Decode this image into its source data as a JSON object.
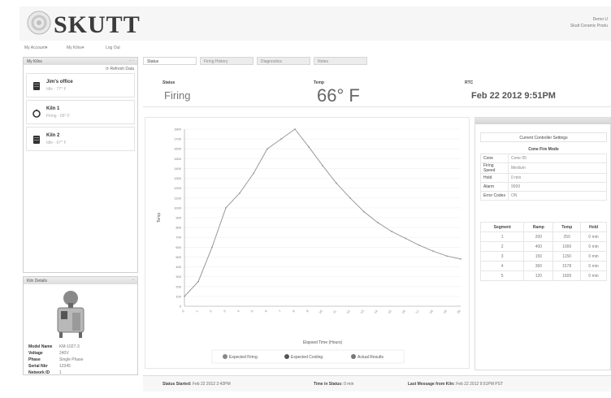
{
  "header": {
    "brand": "SKUTT",
    "user_name": "Demo U",
    "company": "Skutt Ceramic Produ"
  },
  "topnav": [
    {
      "label": "My Account▾"
    },
    {
      "label": "My Kilns▾"
    },
    {
      "label": "Log Out"
    }
  ],
  "kilns_panel": {
    "title": "My Kilns",
    "refresh_label": "Refresh Data",
    "items": [
      {
        "name": "Jim's office",
        "status": "Idle  ·  77° F",
        "icon": "kiln-idle-icon"
      },
      {
        "name": "Kiln 1",
        "status": "Firing  ·  66° F",
        "icon": "kiln-firing-icon"
      },
      {
        "name": "Kiln 2",
        "status": "Idle  ·  67° F",
        "icon": "kiln-idle-icon"
      }
    ]
  },
  "details_panel": {
    "title": "Kiln Details",
    "rows": [
      {
        "k": "Model Name",
        "v": "KM-1027-3"
      },
      {
        "k": "Voltage",
        "v": "240V"
      },
      {
        "k": "Phase",
        "v": "Single Phase"
      },
      {
        "k": "Serial Nbr",
        "v": "12345"
      },
      {
        "k": "Network ID",
        "v": "1"
      }
    ]
  },
  "tabs": [
    {
      "label": "Status"
    },
    {
      "label": "Firing History"
    },
    {
      "label": "Diagnostics"
    },
    {
      "label": "Notes"
    }
  ],
  "status": {
    "status_label": "Status",
    "status_value": "Firing",
    "temp_label": "Temp",
    "temp_value": "66° F",
    "rtc_label": "RTC",
    "rtc_value": "Feb 22 2012 9:51PM"
  },
  "settings": {
    "title": "Current Controller Settings",
    "mode": "Cone Fire Mode",
    "rows": [
      {
        "k": "Cone",
        "v": "Cone 05"
      },
      {
        "k": "Firing Speed",
        "v": "Medium"
      },
      {
        "k": "Hold",
        "v": "0 min"
      },
      {
        "k": "Alarm",
        "v": "9999"
      },
      {
        "k": "Error Codes",
        "v": "ON"
      }
    ],
    "segment_headers": [
      "Segment",
      "Ramp",
      "Temp",
      "Hold"
    ],
    "segments": [
      [
        "1",
        "200",
        "250",
        "0 min"
      ],
      [
        "2",
        "400",
        "1000",
        "0 min"
      ],
      [
        "3",
        "150",
        "1150",
        "0 min"
      ],
      [
        "4",
        "360",
        "1578",
        "0 min"
      ],
      [
        "5",
        "120",
        "1600",
        "0 min"
      ]
    ]
  },
  "footer": {
    "started_label": "Status Started:",
    "started_value": "Feb 22 2012 2:42PM",
    "time_label": "Time in Status:",
    "time_value": "0 min",
    "last_label": "Last Message from Kiln:",
    "last_value": "Feb 22 2012 9:51PM PST"
  },
  "chart_data": {
    "type": "line",
    "xlabel": "Elapsed Time (Hours)",
    "ylabel": "Temp",
    "ylim": [
      0,
      1800
    ],
    "y_ticks": [
      0,
      100,
      200,
      300,
      400,
      500,
      600,
      700,
      800,
      900,
      1000,
      1100,
      1200,
      1300,
      1400,
      1500,
      1600,
      1700,
      1800
    ],
    "legend": [
      {
        "name": "Expected Firing",
        "color": "#888888"
      },
      {
        "name": "Expected Cooling",
        "color": "#555555"
      },
      {
        "name": "Actual Results",
        "color": "#777777"
      }
    ],
    "x": [
      0,
      1,
      2,
      3,
      4,
      5,
      6,
      7,
      8,
      9,
      10,
      11,
      12,
      13,
      14,
      15,
      16,
      17,
      18,
      19,
      20
    ],
    "series": [
      {
        "name": "Actual Results",
        "values": [
          100,
          250,
          600,
          1000,
          1150,
          1350,
          1600,
          1700,
          1800,
          1620,
          1430,
          1250,
          1100,
          960,
          850,
          760,
          690,
          620,
          560,
          510,
          480
        ]
      }
    ],
    "line_color": "#999999",
    "grid": true
  }
}
